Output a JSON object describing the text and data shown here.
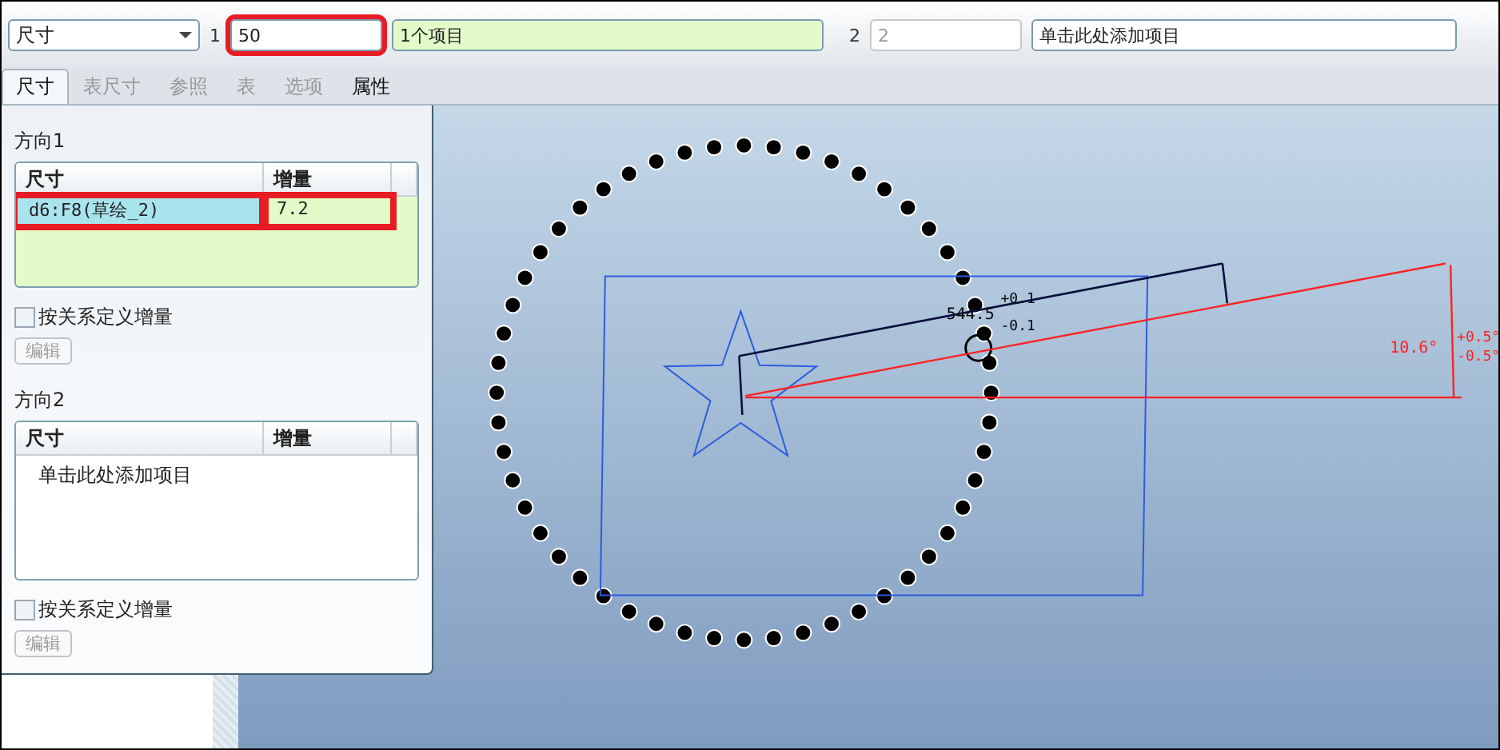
{
  "toolbar": {
    "type_select": {
      "value": "尺寸"
    },
    "direction1": {
      "label": "1",
      "value": "50",
      "highlighted": true
    },
    "items_field": {
      "value": "1个项目"
    },
    "direction2": {
      "label": "2",
      "placeholder": "2"
    },
    "add_field": {
      "value": "单击此处添加项目"
    }
  },
  "tabs": [
    {
      "label": "尺寸",
      "selected": true,
      "disabled": false
    },
    {
      "label": "表尺寸",
      "selected": false,
      "disabled": true
    },
    {
      "label": "参照",
      "selected": false,
      "disabled": true
    },
    {
      "label": "表",
      "selected": false,
      "disabled": true
    },
    {
      "label": "选项",
      "selected": false,
      "disabled": true
    },
    {
      "label": "属性",
      "selected": false,
      "disabled": false
    }
  ],
  "panel": {
    "sections": [
      {
        "title": "方向1",
        "columns": [
          "尺寸",
          "增量"
        ],
        "active": true,
        "rows": [
          {
            "selected": true,
            "cells": [
              {
                "text": "d6:F8(草绘_2)",
                "highlighted": true
              },
              {
                "text": "7.2",
                "highlighted": true
              }
            ]
          }
        ],
        "checkbox": {
          "label": "按关系定义增量",
          "checked": false
        },
        "button": {
          "label": "编辑",
          "disabled": true
        }
      },
      {
        "title": "方向2",
        "columns": [
          "尺寸",
          "增量"
        ],
        "active": false,
        "prompt": "单击此处添加项目",
        "checkbox": {
          "label": "按关系定义增量",
          "checked": false
        },
        "button": {
          "label": "编辑",
          "disabled": true
        }
      }
    ]
  },
  "canvas": {
    "linear_dimension": {
      "value": "544.5",
      "upper": "+0.1",
      "lower": "-0.1"
    },
    "angular_dimension": {
      "value": "10.6°",
      "upper": "+0.5°",
      "lower": "-0.5°"
    }
  }
}
